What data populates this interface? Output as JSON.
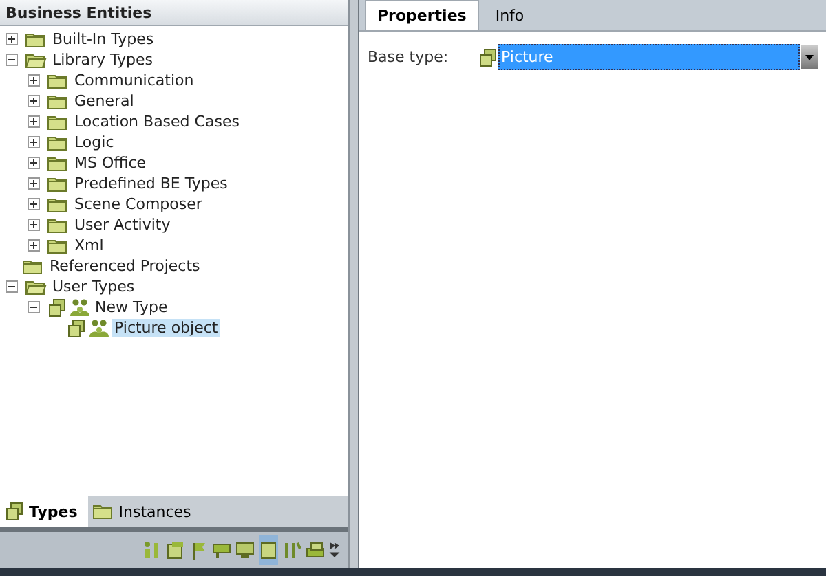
{
  "left_panel": {
    "title": "Business Entities",
    "tree": [
      {
        "label": "Built-In Types",
        "kind": "folder",
        "expanded": false,
        "selected": false
      },
      {
        "label": "Library Types",
        "kind": "folder",
        "expanded": true,
        "selected": false,
        "children": [
          {
            "label": "Communication",
            "kind": "folder",
            "expanded": false,
            "selected": false
          },
          {
            "label": "General",
            "kind": "folder",
            "expanded": false,
            "selected": false
          },
          {
            "label": "Location Based Cases",
            "kind": "folder",
            "expanded": false,
            "selected": false
          },
          {
            "label": "Logic",
            "kind": "folder",
            "expanded": false,
            "selected": false
          },
          {
            "label": "MS Office",
            "kind": "folder",
            "expanded": false,
            "selected": false
          },
          {
            "label": "Predefined BE Types",
            "kind": "folder",
            "expanded": false,
            "selected": false
          },
          {
            "label": "Scene Composer",
            "kind": "folder",
            "expanded": false,
            "selected": false
          },
          {
            "label": "User Activity",
            "kind": "folder",
            "expanded": false,
            "selected": false
          },
          {
            "label": "Xml",
            "kind": "folder",
            "expanded": false,
            "selected": false
          }
        ]
      },
      {
        "label": "Referenced Projects",
        "kind": "folder",
        "selected": false
      },
      {
        "label": "User Types",
        "kind": "folder",
        "expanded": true,
        "selected": false,
        "children": [
          {
            "label": "New Type",
            "kind": "type",
            "expanded": true,
            "selected": false,
            "children": [
              {
                "label": "Picture object",
                "kind": "type",
                "selected": true
              }
            ]
          }
        ]
      }
    ],
    "tabs": [
      {
        "label": "Types",
        "selected": true
      },
      {
        "label": "Instances",
        "selected": false
      }
    ],
    "toolbar": [
      {
        "selected": false
      },
      {
        "selected": false
      },
      {
        "selected": false
      },
      {
        "selected": false
      },
      {
        "selected": false
      },
      {
        "selected": true
      },
      {
        "selected": false
      },
      {
        "selected": false
      }
    ]
  },
  "right_panel": {
    "tabs": [
      {
        "label": "Properties",
        "selected": true
      },
      {
        "label": "Info",
        "selected": false
      }
    ],
    "base_type": {
      "label": "Base type:",
      "value": "Picture"
    }
  }
}
